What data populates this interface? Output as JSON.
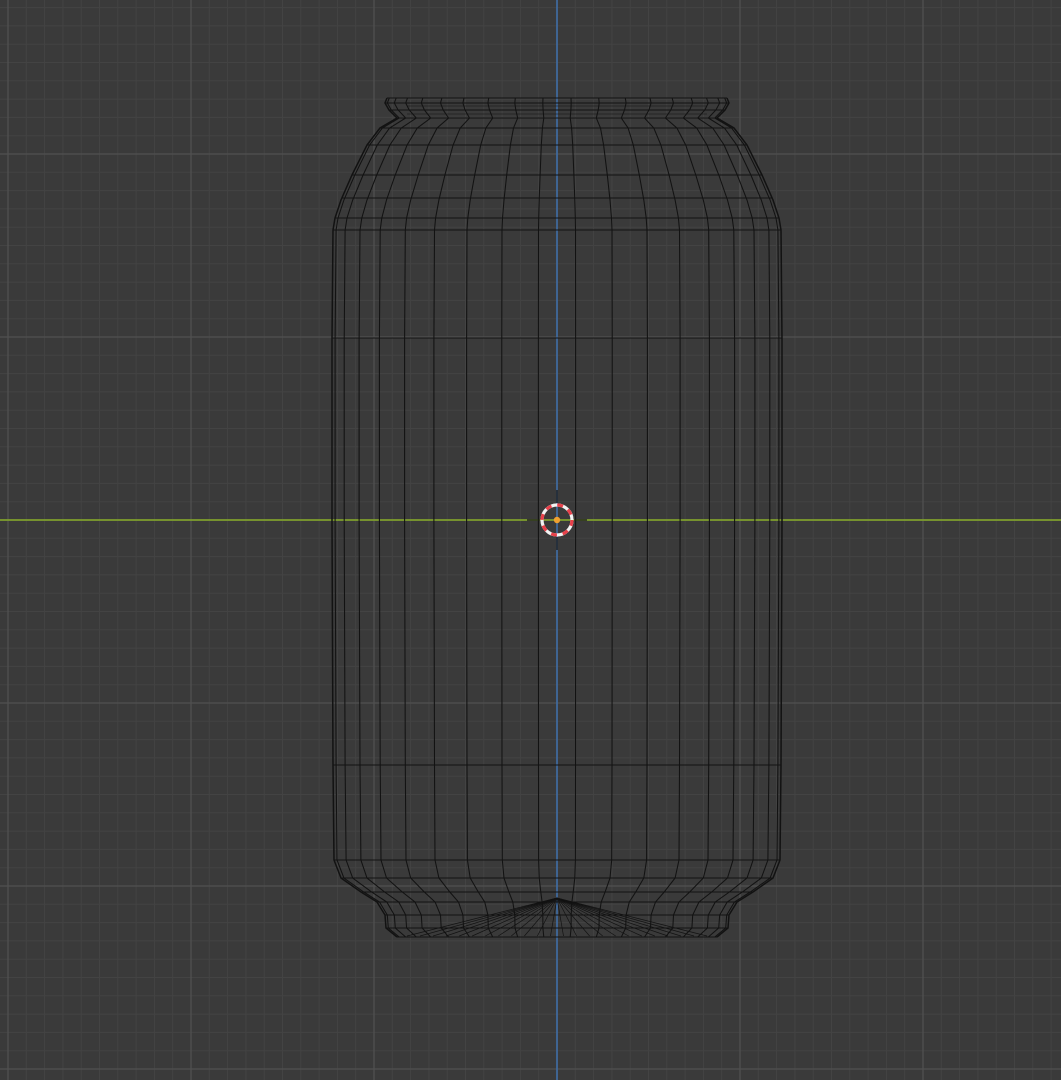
{
  "viewport": {
    "view_mode": "wireframe",
    "object": "can-mesh",
    "colors": {
      "background": "#3a3a3a",
      "grid_minor": "#434343",
      "grid_major": "#505050",
      "x_axis": "#7e9f2c",
      "y_axis": "#3f6da6",
      "wire": "#121212",
      "cursor_red": "#e8404a",
      "cursor_white": "#f2f2f2",
      "origin": "#f0a030"
    }
  }
}
